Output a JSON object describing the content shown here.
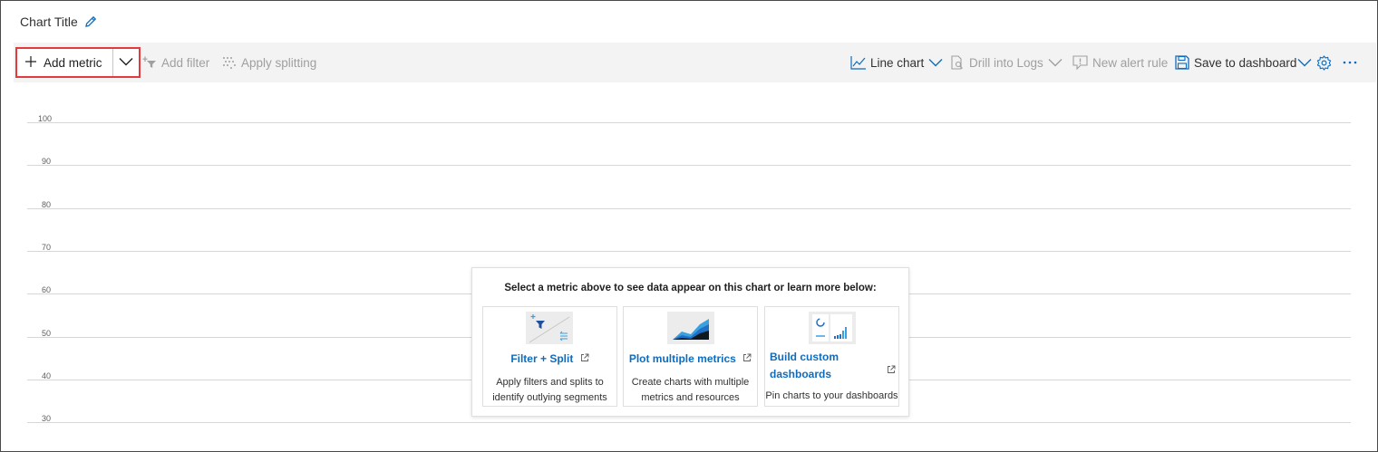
{
  "chart": {
    "title": "Chart Title"
  },
  "toolbar": {
    "add_metric": "Add metric",
    "add_filter": "Add filter",
    "apply_splitting": "Apply splitting",
    "line_chart": "Line chart",
    "drill_into_logs": "Drill into Logs",
    "new_alert_rule": "New alert rule",
    "save_to_dashboard": "Save to dashboard"
  },
  "chart_data": {
    "type": "line",
    "series": [],
    "yticks": [
      "100",
      "90",
      "80",
      "70",
      "60",
      "50",
      "40",
      "30"
    ],
    "grid": true
  },
  "empty_state": {
    "message": "Select a metric above to see data appear on this chart or learn more below:",
    "cards": [
      {
        "title": "Filter + Split",
        "desc_line1": "Apply filters and splits to",
        "desc_line2": "identify outlying segments",
        "icon": "filter-split-illustration"
      },
      {
        "title": "Plot multiple metrics",
        "desc_line1": "Create charts with multiple",
        "desc_line2": "metrics and resources",
        "icon": "area-chart-illustration"
      },
      {
        "title_line1": "Build custom",
        "title_line2": "dashboards",
        "desc_line1": "Pin charts to your dashboards",
        "icon": "dashboard-illustration"
      }
    ]
  },
  "colors": {
    "accent": "#0f6cbd",
    "highlight_border": "#e33b3b",
    "toolbar_bg": "#f3f3f3",
    "disabled_text": "#a19f9d"
  }
}
